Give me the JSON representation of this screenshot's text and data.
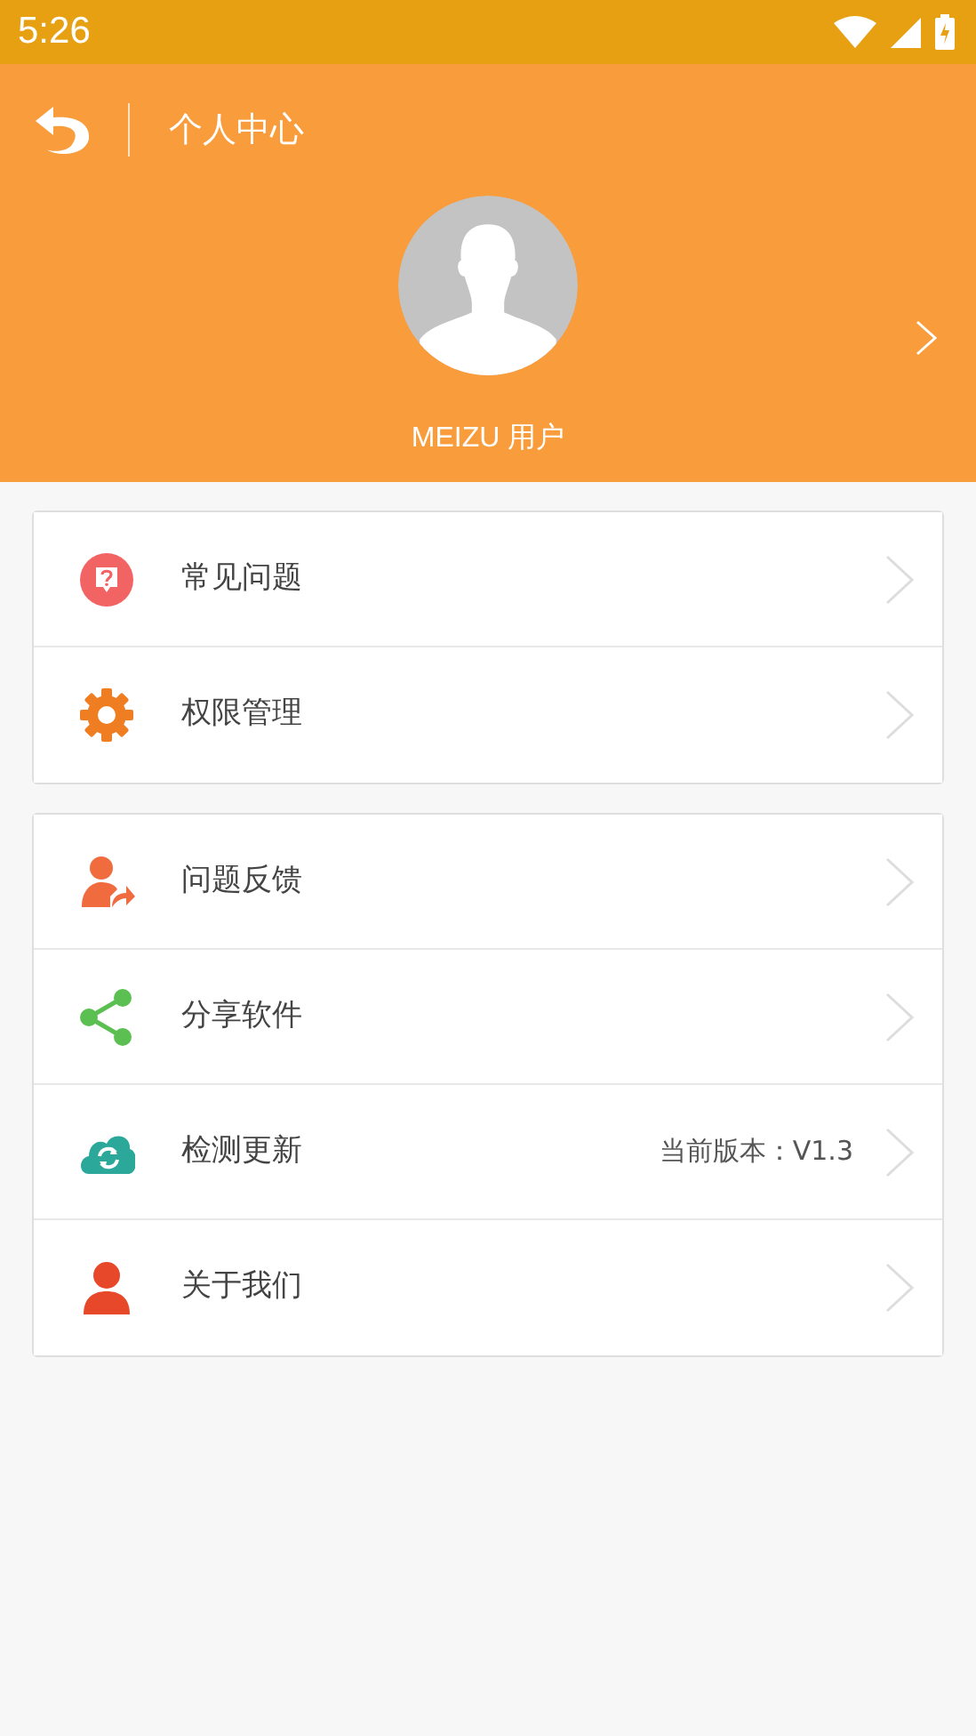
{
  "status_bar": {
    "time": "5:26"
  },
  "header": {
    "title": "个人中心",
    "user_name": "MEIZU 用户"
  },
  "menu_groups": [
    {
      "items": [
        {
          "kind": "question",
          "label": "常见问题"
        },
        {
          "kind": "gear",
          "label": "权限管理"
        }
      ]
    },
    {
      "items": [
        {
          "kind": "feedback",
          "label": "问题反馈"
        },
        {
          "kind": "share",
          "label": "分享软件"
        },
        {
          "kind": "update",
          "label": "检测更新",
          "detail": "当前版本：V1.3"
        },
        {
          "kind": "about",
          "label": "关于我们"
        }
      ]
    }
  ]
}
